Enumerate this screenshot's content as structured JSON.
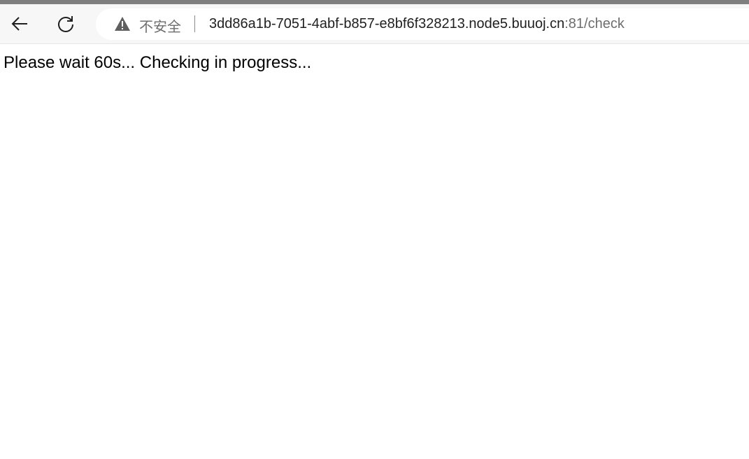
{
  "browser": {
    "back_icon": "arrow-left-icon",
    "reload_icon": "reload-icon",
    "security_icon": "warning-triangle-icon",
    "security_label": "不安全",
    "url_host": "3dd86a1b-7051-4abf-b857-e8bf6f328213.node5.buuoj.cn",
    "url_rest": ":81/check"
  },
  "page": {
    "message": "Please wait 60s... Checking in progress..."
  }
}
